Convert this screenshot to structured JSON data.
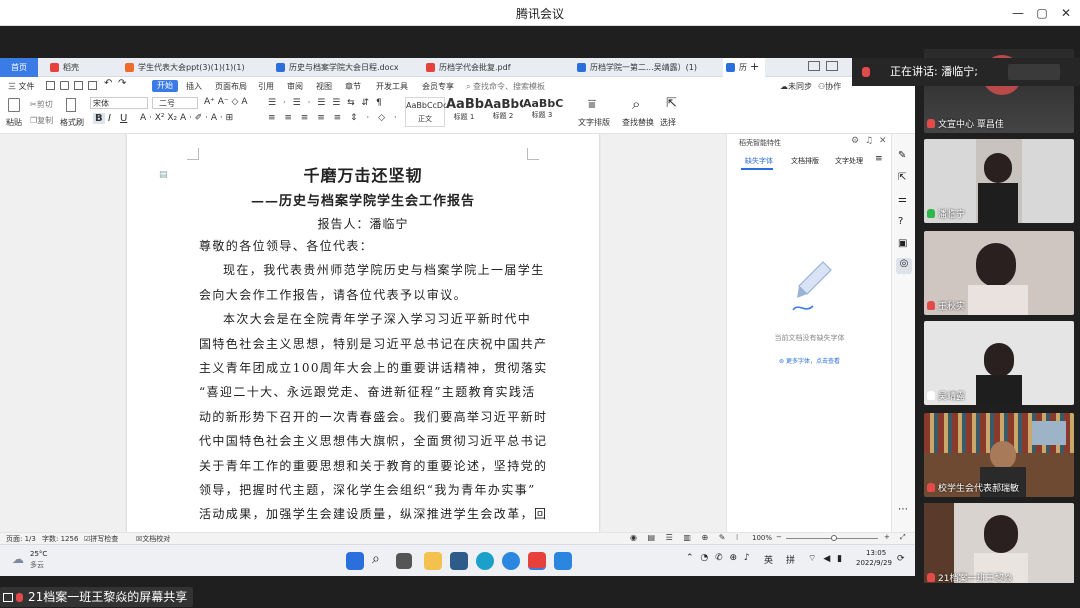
{
  "window": {
    "title": "腾讯会议",
    "controls": [
      "—",
      "▢",
      "✕"
    ]
  },
  "doc_tabs": [
    {
      "label": "首页",
      "color": "#3b7be6"
    },
    {
      "label": "稻壳",
      "color": "#e8413b"
    },
    {
      "label": "学生代表大会ppt(3)(1)(1)(1)",
      "color": "#ef6b2a"
    },
    {
      "label": "历史与档案学院大会日程.docx",
      "color": "#2b6fdc"
    },
    {
      "label": "历档学代会批复.pdf",
      "color": "#e8413b"
    },
    {
      "label": "历档学院一第二...吴靖露）(1)",
      "color": "#2b6fdc"
    },
    {
      "label": "历",
      "color": "#2b6fdc"
    }
  ],
  "menu": {
    "file": "三 文件",
    "items": [
      "开始",
      "插入",
      "页面布局",
      "引用",
      "审阅",
      "视图",
      "章节",
      "开发工具",
      "会员专享"
    ],
    "search": "查找命令、搜索模板",
    "unsynced": "未同步",
    "collab": "协作",
    "share": "分享"
  },
  "ribbon": {
    "paste": "粘贴",
    "cut": "剪切",
    "copy": "复制",
    "format_painter": "格式刷",
    "font_name": "宋体",
    "font_size": "二号",
    "styles": [
      {
        "preview": "AaBbCcDd",
        "name": "正文"
      },
      {
        "preview": "AaBb",
        "name": "标题 1"
      },
      {
        "preview": "AaBbC",
        "name": "标题 2"
      },
      {
        "preview": "AaBbC",
        "name": "标题 3"
      }
    ],
    "text_layout": "文字排版",
    "find_replace": "查找替换",
    "select": "选择"
  },
  "document": {
    "title": "千磨万击还坚韧",
    "subtitle": "——历史与档案学院学生会工作报告",
    "reporter": "报告人：潘临宁",
    "lines": [
      "尊敬的各位领导、各位代表：",
      "现在，我代表贵州师范学院历史与档案学院上一届学生",
      "会向大会作工作报告，请各位代表予以审议。",
      "本次大会是在全院青年学子深入学习习近平新时代中",
      "国特色社会主义思想，特别是习近平总书记在庆祝中国共产",
      "主义青年团成立100周年大会上的重要讲话精神，贯彻落实",
      "“喜迎二十大、永远跟党走、奋进新征程”主题教育实践活",
      "动的新形势下召开的一次青春盛会。我们要高举习近平新时",
      "代中国特色社会主义思想伟大旗帜，全面贯彻习近平总书记",
      "关于青年工作的重要思想和关于教育的重要论述，坚持党的",
      "领导，把握时代主题，深化学生会组织“我为青年办实事”",
      "活动成果，加强学生会建设质量，纵深推进学生会改革，回"
    ]
  },
  "sidebar": {
    "title": "稻壳智能特性",
    "tabs": [
      "缺失字体",
      "文档排版",
      "文字处理"
    ],
    "empty_text": "当前文档没有缺失字体",
    "more_link": "更多字体，点击查看"
  },
  "status": {
    "page": "页面: 1/3",
    "words": "字数: 1256",
    "spell": "拼写检查",
    "proof": "文档校对",
    "zoom": "100%"
  },
  "taskbar": {
    "weather_temp": "25°C",
    "weather_desc": "多云",
    "ime1": "英",
    "ime2": "拼",
    "time": "13:05",
    "date": "2022/9/29"
  },
  "meeting": {
    "speaking_label": "正在讲话: 潘临宁;",
    "participants": [
      {
        "name": "文宣中心 覃昌佳",
        "mic": "muted"
      },
      {
        "name": "潘临宁",
        "mic": "on"
      },
      {
        "name": "王秋实",
        "mic": "muted"
      },
      {
        "name": "吴靖露",
        "mic": "idle"
      },
      {
        "name": "校学生会代表郝瑞敏",
        "mic": "muted"
      },
      {
        "name": "21档案一班王黎焱",
        "mic": "muted"
      }
    ],
    "screen_share_label": "21档案一班王黎焱的屏幕共享"
  },
  "colors": {
    "accent": "#3b7be6",
    "wps_red": "#e8413b",
    "muted_mic": "#e34b4b",
    "active_mic": "#2fb74a"
  }
}
